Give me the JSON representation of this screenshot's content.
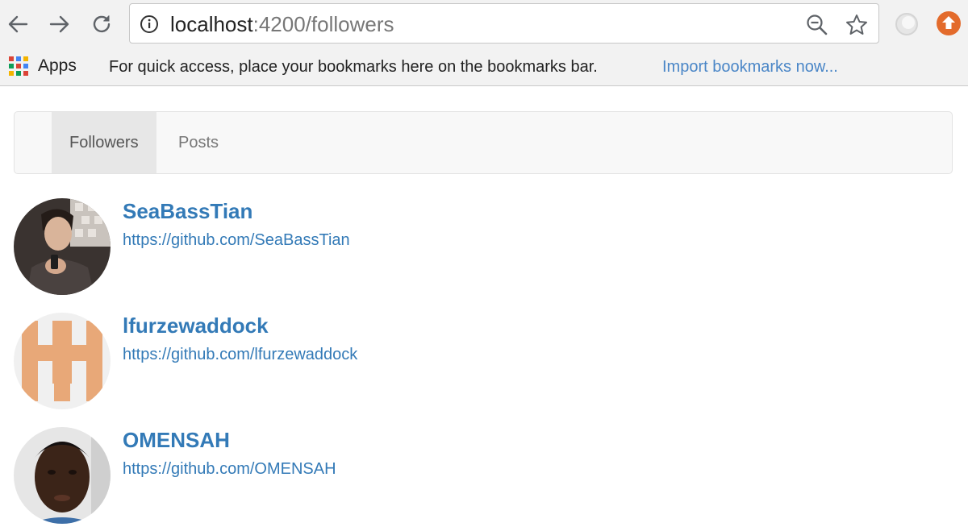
{
  "browser": {
    "url_host": "localhost",
    "url_rest": ":4200/followers",
    "apps_label": "Apps",
    "bookmarks_message": "For quick access, place your bookmarks here on the bookmarks bar.",
    "import_link": "Import bookmarks now...",
    "icons": [
      "back-icon",
      "forward-icon",
      "reload-icon",
      "info-icon",
      "zoom-icon",
      "star-icon",
      "extension-icon",
      "extension-upload-icon",
      "apps-icon"
    ]
  },
  "navbar": {
    "tabs": [
      {
        "label": "Followers",
        "active": true
      },
      {
        "label": "Posts",
        "active": false
      }
    ]
  },
  "followers": [
    {
      "login": "SeaBassTian",
      "url": "https://github.com/SeaBassTian",
      "avatar": "photo"
    },
    {
      "login": "lfurzewaddock",
      "url": "https://github.com/lfurzewaddock",
      "avatar": "identicon"
    },
    {
      "login": "OMENSAH",
      "url": "https://github.com/OMENSAH",
      "avatar": "photo"
    }
  ],
  "colors": {
    "link": "#337ab7",
    "identicon": "#e8a878",
    "upload_badge": "#e36b2c"
  }
}
